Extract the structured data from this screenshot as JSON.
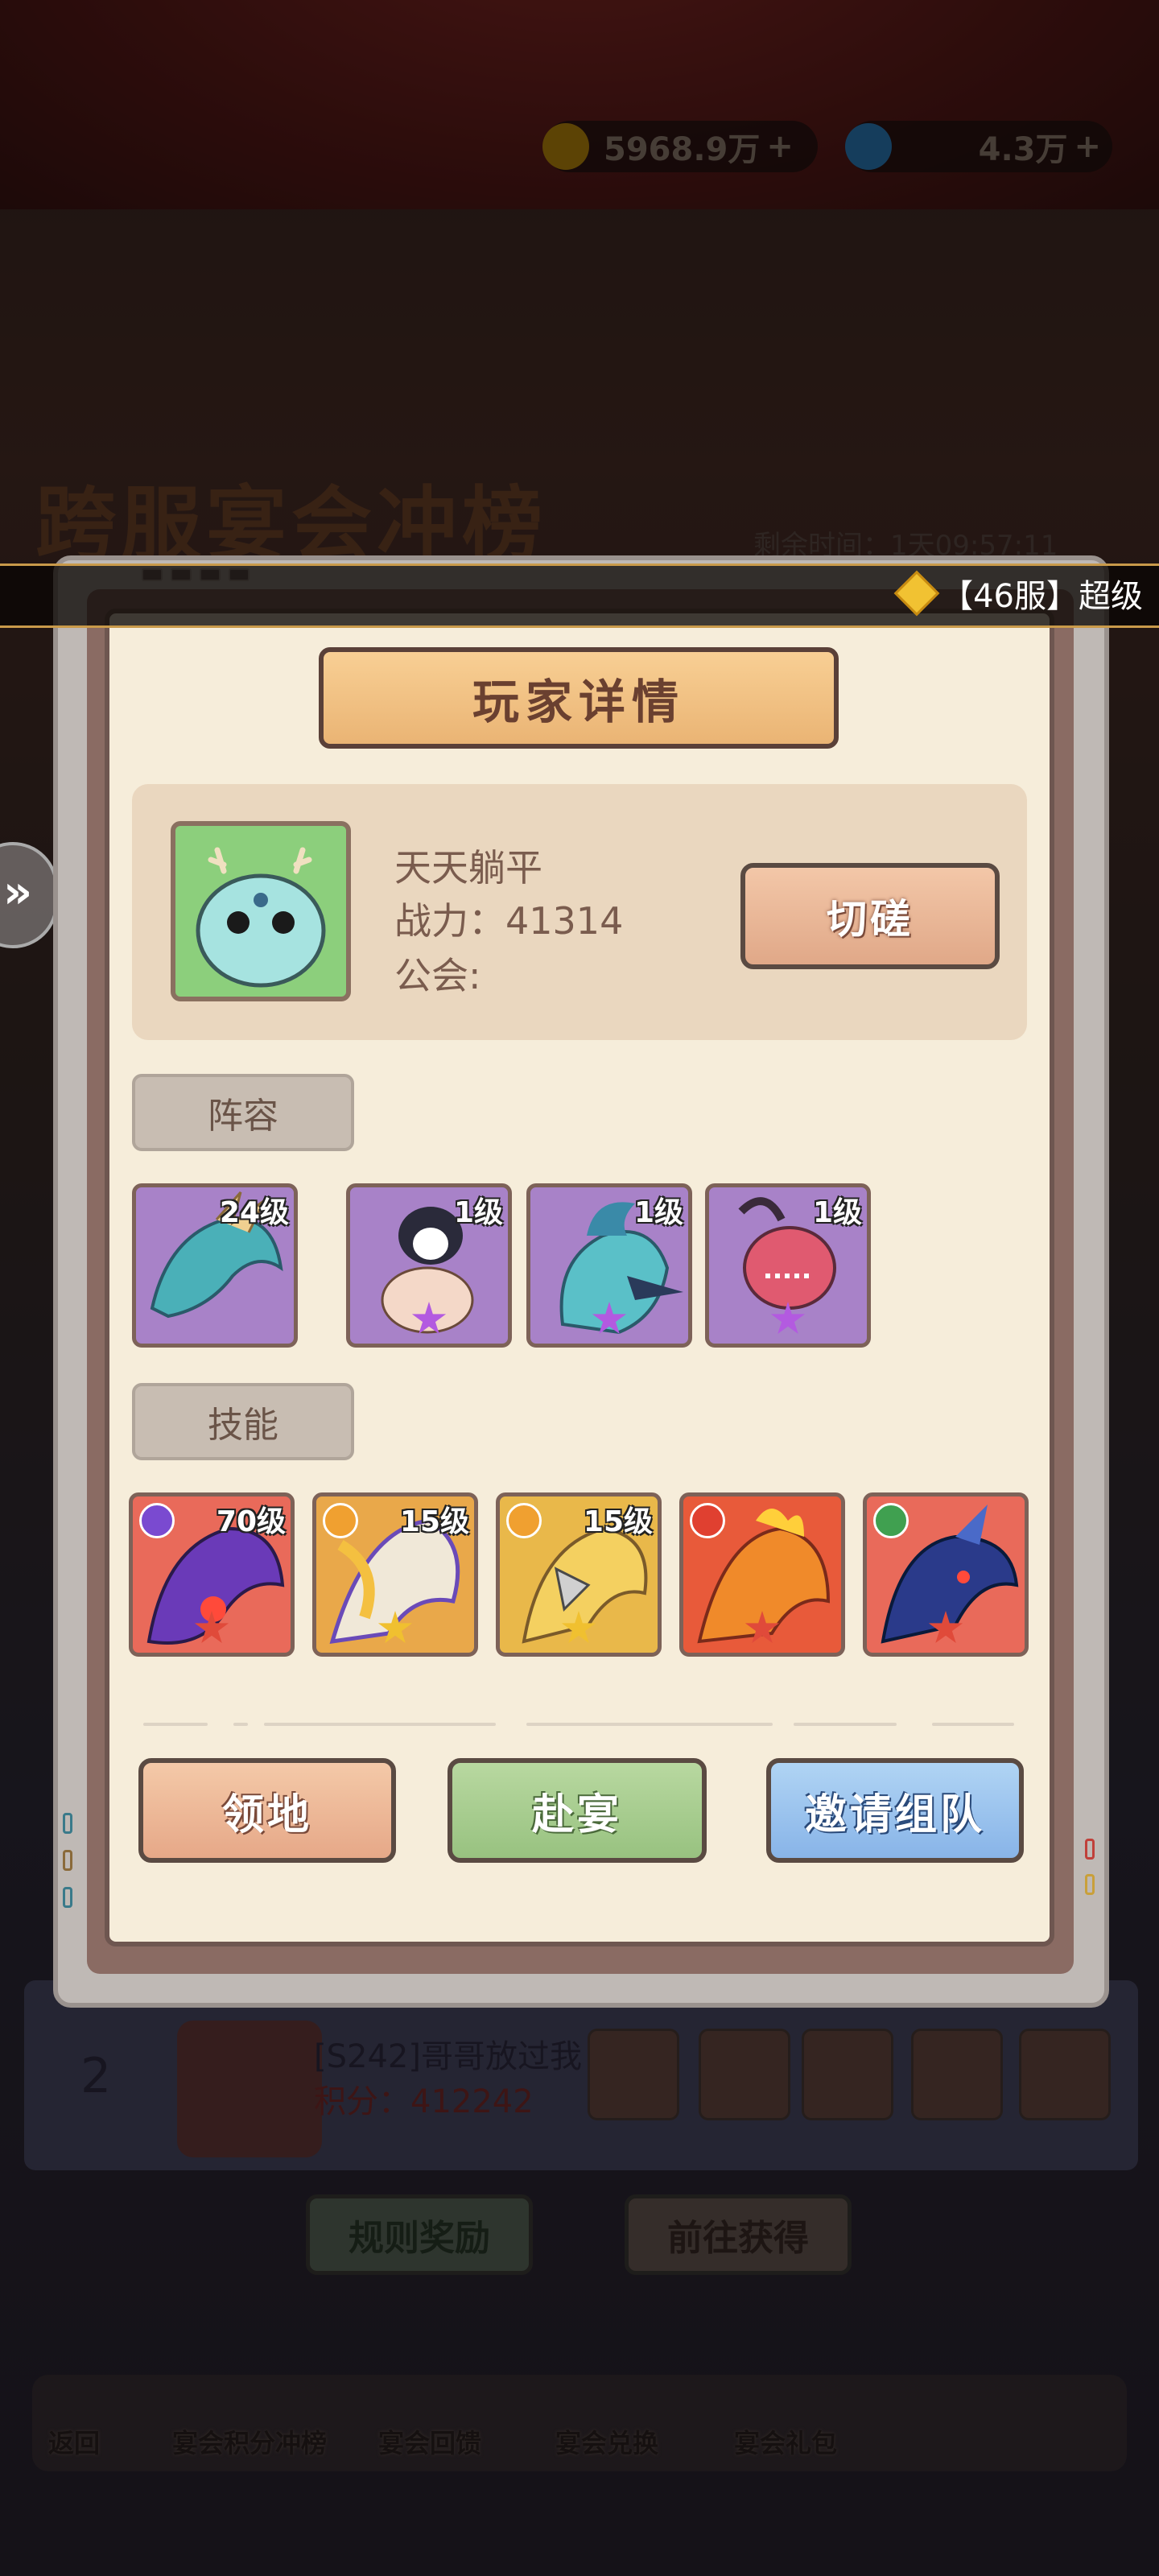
{
  "resources": {
    "gold": "5968.9万",
    "diamonds": "4.3万",
    "gold_icon": "gold-coin-icon",
    "diamond_icon": "diamond-icon"
  },
  "event": {
    "title": "跨服宴会冲榜",
    "remaining_time": "剩余时间：1天09:57:11"
  },
  "marquee": {
    "text": "【46服】超级"
  },
  "dialog": {
    "title": "玩家详情",
    "player": {
      "name": "天天躺平",
      "power": "战力：41314",
      "guild": "公会:"
    },
    "spar_label": "切磋",
    "lineup_label": "阵容",
    "lineup": [
      {
        "level": "24级",
        "name": "golden-dragon"
      },
      {
        "level": "1级",
        "name": "penguin-chef"
      },
      {
        "level": "1级",
        "name": "blue-bird"
      },
      {
        "level": "1级",
        "name": "red-mask-creature"
      }
    ],
    "skills_label": "技能",
    "skills": [
      {
        "level": "70级",
        "name": "purple-dragon"
      },
      {
        "level": "15级",
        "name": "white-gold-dragon"
      },
      {
        "level": "15级",
        "name": "gold-dragon"
      },
      {
        "level": "",
        "name": "fire-dragon"
      },
      {
        "level": "",
        "name": "blue-shark-dragon"
      }
    ],
    "buttons": {
      "territory": "领地",
      "feast": "赴宴",
      "invite": "邀请组队"
    }
  },
  "ranking_row": {
    "rank": "2",
    "name": "[S242]哥哥放过我",
    "score": "积分：412242"
  },
  "background_buttons": {
    "rules": "规则奖励",
    "go_get": "前往获得"
  },
  "nav": {
    "back": "返回",
    "items": [
      "宴会积分冲榜",
      "宴会回馈",
      "宴会兑换",
      "宴会礼包"
    ]
  },
  "colors": {
    "panel": "#f6edda",
    "accent_orange": "#eab474",
    "button_green": "#98c280",
    "button_blue": "#88b4e8"
  }
}
